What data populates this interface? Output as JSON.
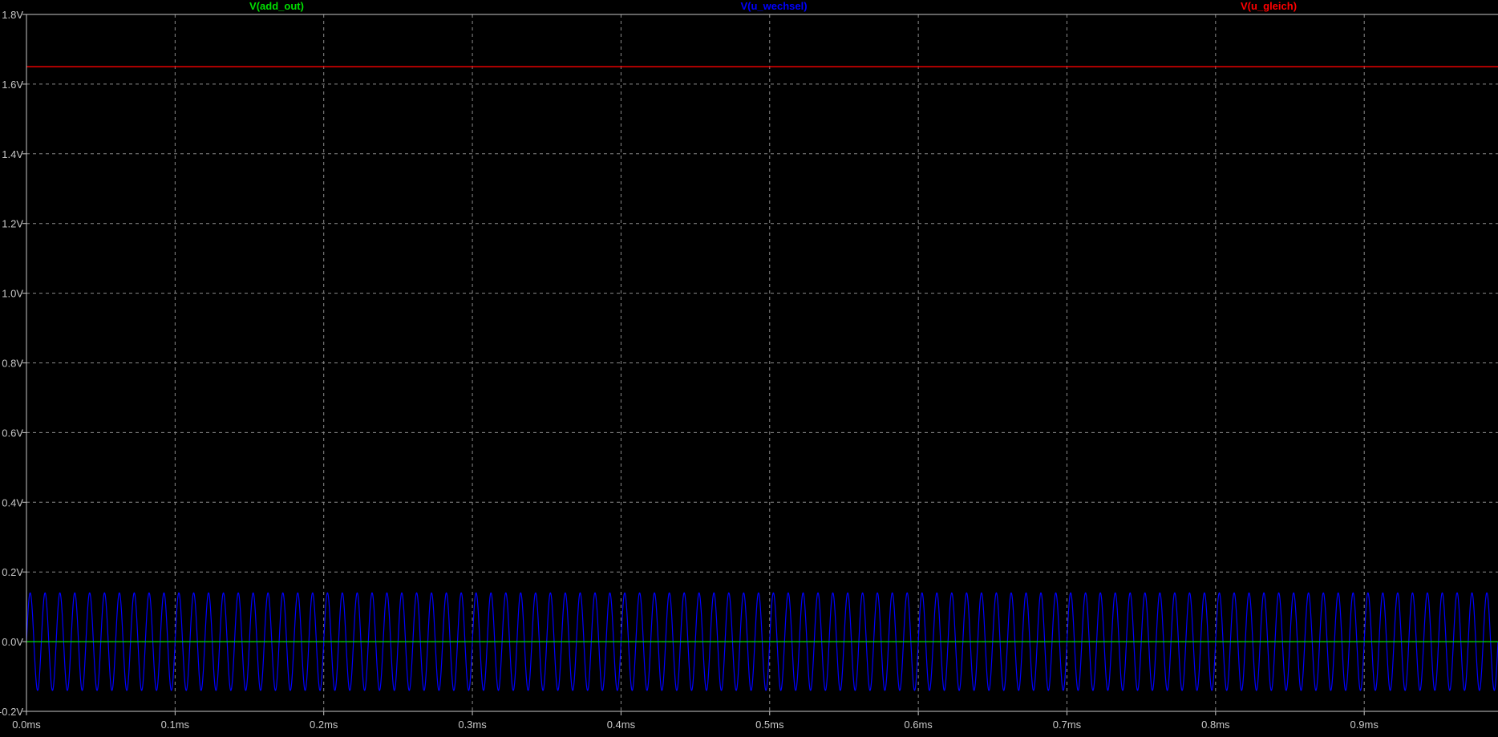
{
  "chart_data": {
    "type": "line",
    "title": "",
    "xlabel": "",
    "ylabel": "",
    "background": "#000000",
    "grid": true,
    "grid_color": "#8c8c8c",
    "axis_color": "#c8c8c8",
    "xlim": [
      0,
      0.99
    ],
    "ylim": [
      -0.2,
      1.8
    ],
    "x_unit": "ms",
    "y_unit": "V",
    "x_ticks": [
      0.0,
      0.1,
      0.2,
      0.3,
      0.4,
      0.5,
      0.6,
      0.7,
      0.8,
      0.9
    ],
    "x_tick_labels": [
      "0.0ms",
      "0.1ms",
      "0.2ms",
      "0.3ms",
      "0.4ms",
      "0.5ms",
      "0.6ms",
      "0.7ms",
      "0.8ms",
      "0.9ms"
    ],
    "y_ticks": [
      -0.2,
      0.0,
      0.2,
      0.4,
      0.6,
      0.8,
      1.0,
      1.2,
      1.4,
      1.6,
      1.8
    ],
    "y_tick_labels": [
      "-0.2V",
      "0.0V",
      "0.2V",
      "0.4V",
      "0.6V",
      "0.8V",
      "1.0V",
      "1.2V",
      "1.4V",
      "1.6V",
      "1.8V"
    ],
    "legend_placement": "top",
    "series": [
      {
        "name": "V(add_out)",
        "color": "#00e000",
        "kind": "constant",
        "value": 0.0
      },
      {
        "name": "V(u_wechsel)",
        "color": "#0000ff",
        "kind": "sine",
        "amplitude": 0.14,
        "offset": 0.0,
        "frequency_khz": 100
      },
      {
        "name": "V(u_gleich)",
        "color": "#ff0000",
        "kind": "constant",
        "value": 1.65
      }
    ]
  }
}
